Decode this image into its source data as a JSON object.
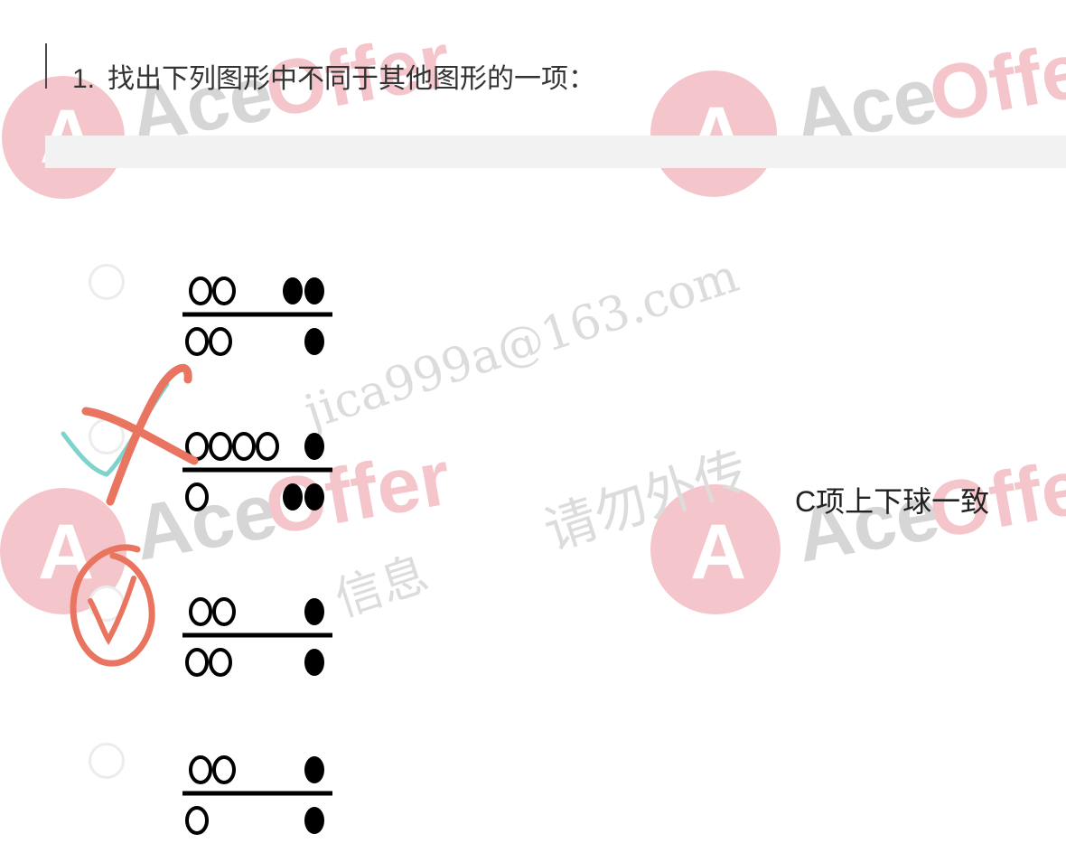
{
  "question": {
    "number": "1.",
    "text": "找出下列图形中不同于其他图形的一项："
  },
  "options": [
    {
      "key": "A",
      "top_open": 2,
      "top_filled": 2,
      "bottom_open": 2,
      "bottom_filled": 1
    },
    {
      "key": "B",
      "top_open": 4,
      "top_filled": 1,
      "bottom_open": 1,
      "bottom_filled": 2
    },
    {
      "key": "C",
      "top_open": 2,
      "top_filled": 1,
      "bottom_open": 2,
      "bottom_filled": 1
    },
    {
      "key": "D",
      "top_open": 2,
      "top_filled": 1,
      "bottom_open": 1,
      "bottom_filled": 1
    }
  ],
  "annotation": {
    "note": "C项上下球一致"
  },
  "watermarks": {
    "brand_prefix": "Ace",
    "brand_suffix": "Offer",
    "brand_letter": "A",
    "email": "jica999a@163.com",
    "warning": "请勿外传",
    "info": "信息",
    "colors": {
      "brand_red": "#f4c6cb",
      "brand_gray": "#d6d6d6"
    }
  },
  "colors": {
    "ink": "#000000",
    "mark_red": "#e9745f",
    "mark_teal": "#7fd3cc",
    "radio_border": "#ececec"
  }
}
